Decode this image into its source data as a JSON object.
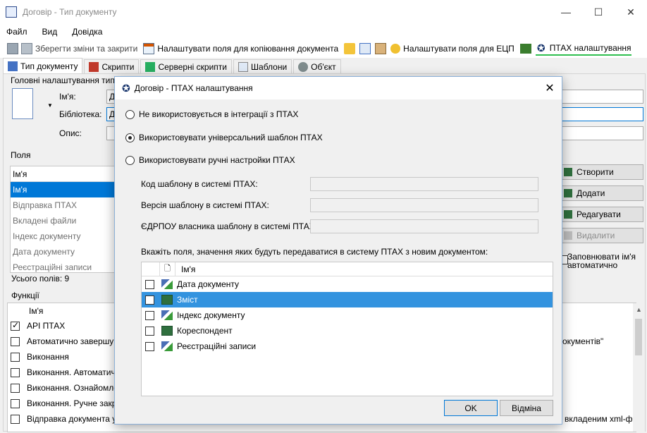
{
  "window": {
    "title": "Договір - Тип документу",
    "controls": {
      "minimize": "—",
      "maximize": "☐",
      "close": "✕"
    }
  },
  "menu": [
    "Файл",
    "Вид",
    "Довідка"
  ],
  "toolbar": {
    "save_close": "Зберегти зміни та закрити",
    "copy_fields": "Налаштувати поля для копіювання документа",
    "ecp_fields": "Налаштувати поля для ЕЦП",
    "ptah_settings": "ПТАХ налаштування"
  },
  "tabs": [
    "Тип документу",
    "Скрипти",
    "Серверні скрипти",
    "Шаблони",
    "Об'єкт"
  ],
  "background": {
    "main_group": "Головні налаштування типу д",
    "name_label": "Ім'я:",
    "name_value": "Д",
    "library_label": "Бібліотека:",
    "library_value": "Д",
    "desc_label": "Опис:",
    "fields_group": "Поля",
    "fields_header": "Ім'я",
    "fields": [
      "Ім'я",
      "Відправка ПТАХ",
      "Вкладені файли",
      "Індекс документу",
      "Дата документу",
      "Реєстраційні записи"
    ],
    "fields_total": "Усього полів: 9",
    "buttons": {
      "create": "Створити",
      "add": "Додати",
      "edit": "Редагувати",
      "delete": "Видалити"
    },
    "autofill": "Заповнювати ім'я автоматично",
    "functions_group": "Функції",
    "functions_header": "Ім'я",
    "functions": [
      {
        "label": "API ПТАХ",
        "checked": true
      },
      {
        "label": "Автоматично завершуват",
        "checked": false
      },
      {
        "label": "Виконання",
        "checked": false
      },
      {
        "label": "Виконання. Автоматичне",
        "checked": false
      },
      {
        "label": "Виконання. Ознайомлен",
        "checked": false
      },
      {
        "label": "Виконання. Ручне закрит",
        "checked": false
      },
      {
        "label": "Відправка документа у в",
        "checked": false
      }
    ],
    "right_text_1": "окументів\"",
    "right_text_2": "вкладеним xml-ф..."
  },
  "dialog": {
    "title": "Договір - ПТАХ налаштування",
    "close": "✕",
    "radios": [
      {
        "label": "Не використовується в інтеграції з ПТАХ",
        "selected": false
      },
      {
        "label": "Використовувати універсальний шаблон ПТАХ",
        "selected": true
      },
      {
        "label": "Використовувати ручні настройки ПТАХ",
        "selected": false
      }
    ],
    "template_code_label": "Код шаблону в системі ПТАХ:",
    "template_version_label": "Версія шаблону в системі ПТАХ:",
    "template_owner_label": "ЄДРПОУ власника шаблону в системі ПТАХ:",
    "fields_prompt": "Вкажіть поля, значення яких будуть передаватися в систему ПТАХ з новим документом:",
    "grid_header": "Ім'я",
    "grid_rows": [
      {
        "label": "Дата документу",
        "icon": "link-field-icon",
        "selected": false
      },
      {
        "label": "Зміст",
        "icon": "text-field-icon",
        "selected": true
      },
      {
        "label": "Індекс документу",
        "icon": "link-field-icon",
        "selected": false
      },
      {
        "label": "Кореспондент",
        "icon": "text-field-icon",
        "selected": false
      },
      {
        "label": "Реєстраційні записи",
        "icon": "link-field-icon",
        "selected": false
      }
    ],
    "ok": "OK",
    "cancel": "Відміна"
  }
}
